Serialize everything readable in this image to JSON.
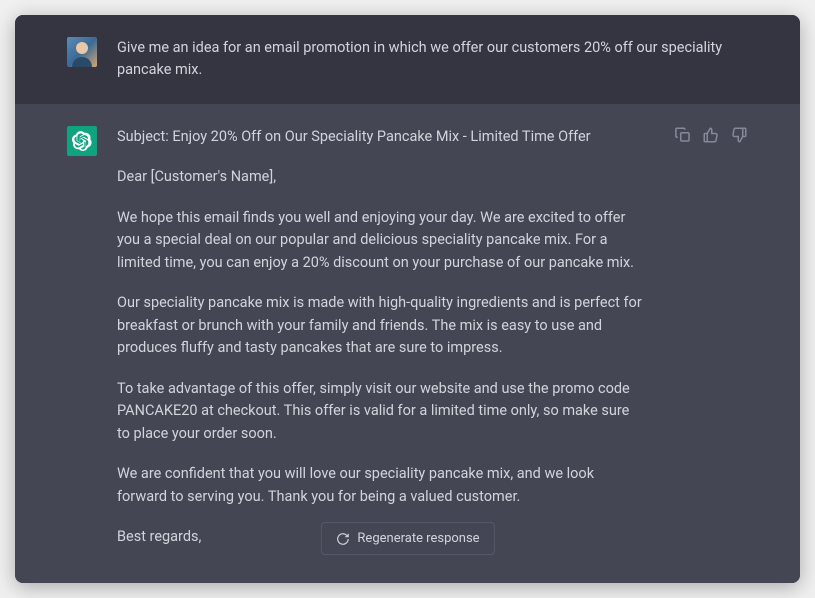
{
  "user_message": "Give me an idea for an email promotion in which we offer our customers 20% off our speciality pancake mix.",
  "assistant": {
    "subject": "Subject: Enjoy 20% Off on Our Speciality Pancake Mix - Limited Time Offer",
    "greeting": "Dear [Customer's Name],",
    "p1": "We hope this email finds you well and enjoying your day. We are excited to offer you a special deal on our popular and delicious speciality pancake mix. For a limited time, you can enjoy a 20% discount on your purchase of our pancake mix.",
    "p2": "Our speciality pancake mix is made with high-quality ingredients and is perfect for breakfast or brunch with your family and friends. The mix is easy to use and produces fluffy and tasty pancakes that are sure to impress.",
    "p3": "To take advantage of this offer, simply visit our website and use the promo code PANCAKE20 at checkout. This offer is valid for a limited time only, so make sure to place your order soon.",
    "p4": "We are confident that you will love our speciality pancake mix, and we look forward to serving you. Thank you for being a valued customer.",
    "signoff": "Best regards,"
  },
  "regenerate_label": "Regenerate response"
}
